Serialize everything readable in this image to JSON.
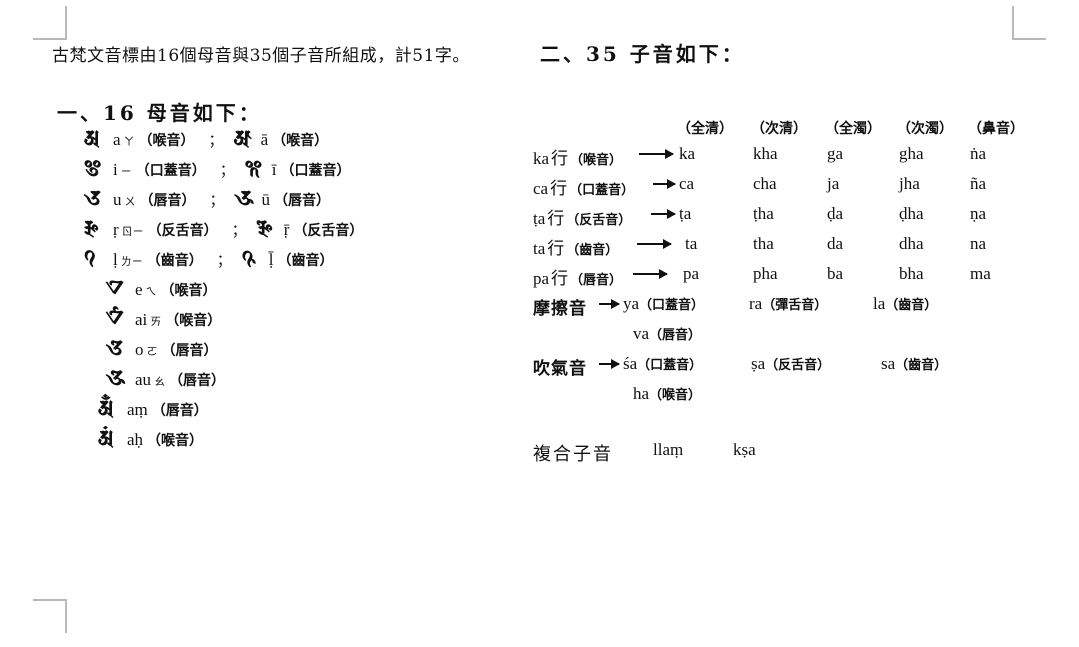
{
  "document": {
    "intro_line": "古梵文音標由16個母音與35個子音所組成，計51字。",
    "section_two_heading": "二、35 子音如下：",
    "section_one_heading": "一、16 母音如下："
  },
  "vowels": {
    "separator": "；",
    "rows": [
      {
        "glyph_left": "𑖀",
        "latin_left": "a",
        "bopomofo_left": "ㄚ",
        "place_left": "（喉音）",
        "glyph_right": "𑖁",
        "latin_right": "ā",
        "bopomofo_right": "",
        "place_right": "（喉音）"
      },
      {
        "glyph_left": "𑖂",
        "latin_left": "i",
        "bopomofo_left": "ㄧ",
        "place_left": "（口蓋音）",
        "glyph_right": "𑖃",
        "latin_right": "ī",
        "bopomofo_right": "",
        "place_right": "（口蓋音）"
      },
      {
        "glyph_left": "𑖄",
        "latin_left": "u",
        "bopomofo_left": "ㄨ",
        "place_left": "（唇音）",
        "glyph_right": "𑖅",
        "latin_right": "ū",
        "bopomofo_right": "",
        "place_right": "（唇音）"
      },
      {
        "glyph_left": "𑖆",
        "latin_left": "ṛ",
        "bopomofo_left": "ㄖㄧ",
        "place_left": "（反舌音）",
        "glyph_right": "𑖇",
        "latin_right": "ṝ",
        "bopomofo_right": "",
        "place_right": "（反舌音）"
      },
      {
        "glyph_left": "𑖈",
        "latin_left": "ḷ",
        "bopomofo_left": "ㄌㄧ",
        "place_left": "（齒音）",
        "glyph_right": "𑖉",
        "latin_right": "ḹ",
        "bopomofo_right": "",
        "place_right": "（齒音）"
      },
      {
        "glyph_left": "𑖊",
        "latin_left": "e",
        "bopomofo_left": "ㄟ",
        "place_left": "（喉音）",
        "glyph_right": "",
        "latin_right": "",
        "bopomofo_right": "",
        "place_right": ""
      },
      {
        "glyph_left": "𑖋",
        "latin_left": "ai",
        "bopomofo_left": "ㄞ",
        "place_left": "（喉音）",
        "glyph_right": "",
        "latin_right": "",
        "bopomofo_right": "",
        "place_right": ""
      },
      {
        "glyph_left": "𑖌",
        "latin_left": "o",
        "bopomofo_left": "ㄛ",
        "place_left": "（唇音）",
        "glyph_right": "",
        "latin_right": "",
        "bopomofo_right": "",
        "place_right": ""
      },
      {
        "glyph_left": "𑖍",
        "latin_left": "au",
        "bopomofo_left": "ㄠ",
        "place_left": "（唇音）",
        "glyph_right": "",
        "latin_right": "",
        "bopomofo_right": "",
        "place_right": ""
      },
      {
        "glyph_left": "𑖀𑖼",
        "latin_left": "aṃ",
        "bopomofo_left": "",
        "place_left": "（唇音）",
        "glyph_right": "",
        "latin_right": "",
        "bopomofo_right": "",
        "place_right": ""
      },
      {
        "glyph_left": "𑖀𑖽",
        "latin_left": "aḥ",
        "bopomofo_left": "",
        "place_left": "（喉音）",
        "glyph_right": "",
        "latin_right": "",
        "bopomofo_right": "",
        "place_right": ""
      }
    ]
  },
  "consonants": {
    "column_headers": [
      "（全清）",
      "（次清）",
      "（全濁）",
      "（次濁）",
      "（鼻音）"
    ],
    "rows": [
      {
        "series": "ka",
        "hang": "行",
        "place": "（喉音）",
        "cells": [
          "ka",
          "kha",
          "ga",
          "gha",
          "ṅa"
        ]
      },
      {
        "series": "ca",
        "hang": "行",
        "place": "（口蓋音）",
        "cells": [
          "ca",
          "cha",
          "ja",
          "jha",
          "ña"
        ]
      },
      {
        "series": "ṭa",
        "hang": "行",
        "place": "（反舌音）",
        "cells": [
          "ṭa",
          "ṭha",
          "ḍa",
          "ḍha",
          "ṇa"
        ]
      },
      {
        "series": "ta",
        "hang": "行",
        "place": "（齒音）",
        "cells": [
          "ta",
          "tha",
          "da",
          "dha",
          "na"
        ]
      },
      {
        "series": "pa",
        "hang": "行",
        "place": "（唇音）",
        "cells": [
          "pa",
          "pha",
          "ba",
          "bha",
          "ma"
        ]
      }
    ],
    "fricatives": {
      "name": "摩擦音",
      "items": [
        {
          "letter": "ya",
          "place": "（口蓋音）"
        },
        {
          "letter": "ra",
          "place": "（彈舌音）"
        },
        {
          "letter": "la",
          "place": "（齒音）"
        }
      ],
      "continuation": {
        "letter": "va",
        "place": "（唇音）"
      }
    },
    "aspirates": {
      "name": "吹氣音",
      "items": [
        {
          "letter": "śa",
          "place": "（口蓋音）"
        },
        {
          "letter": "ṣa",
          "place": "（反舌音）"
        },
        {
          "letter": "sa",
          "place": "（齒音）"
        }
      ],
      "continuation": {
        "letter": "ha",
        "place": "（喉音）"
      }
    },
    "compound": {
      "name": "複合子音",
      "items": [
        "llaṃ",
        "kṣa"
      ]
    }
  }
}
